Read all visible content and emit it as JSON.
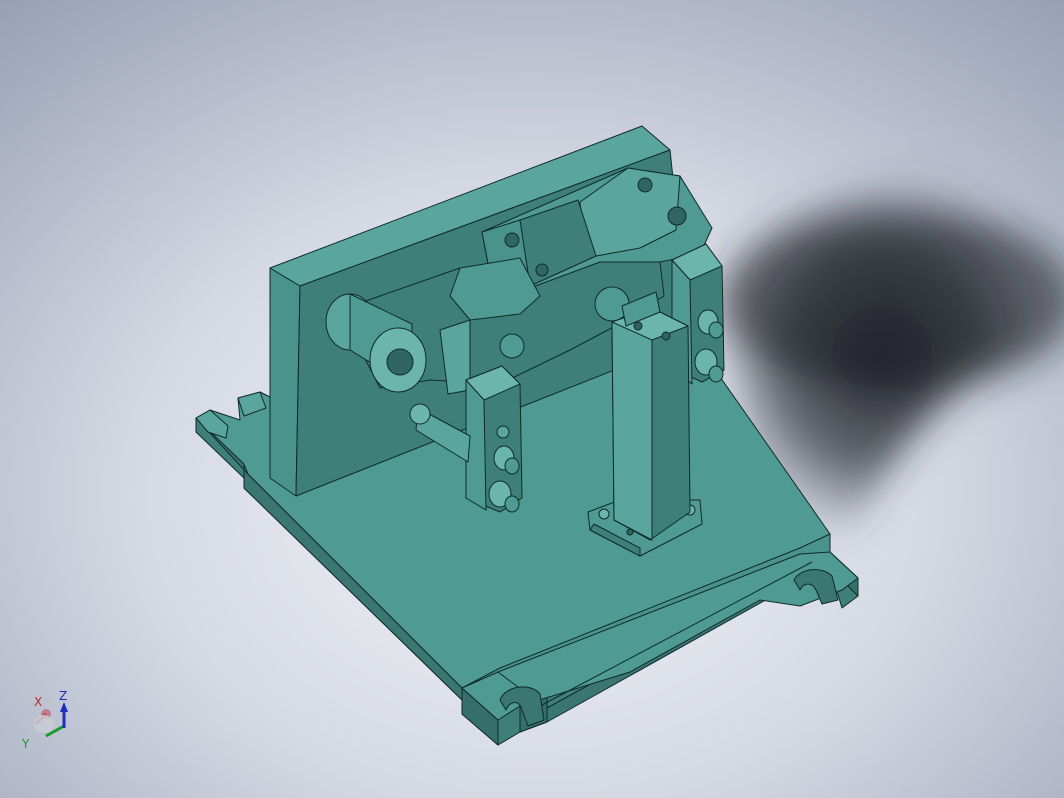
{
  "viewport": {
    "background_colors": [
      "#f4f5f9",
      "#d4d8e2",
      "#a9b0c2",
      "#8f97ab"
    ],
    "part_colors": {
      "face_top": "#4f9a93",
      "face_front": "#3f7f7a",
      "face_light": "#6cb5ad",
      "face_dark": "#2f6662",
      "edge": "#0f2a28"
    }
  },
  "triad": {
    "x_label": "X",
    "y_label": "Y",
    "z_label": "Z",
    "x_color": "#c0282b",
    "y_color": "#1a9a2a",
    "z_color": "#1d2fbf"
  }
}
